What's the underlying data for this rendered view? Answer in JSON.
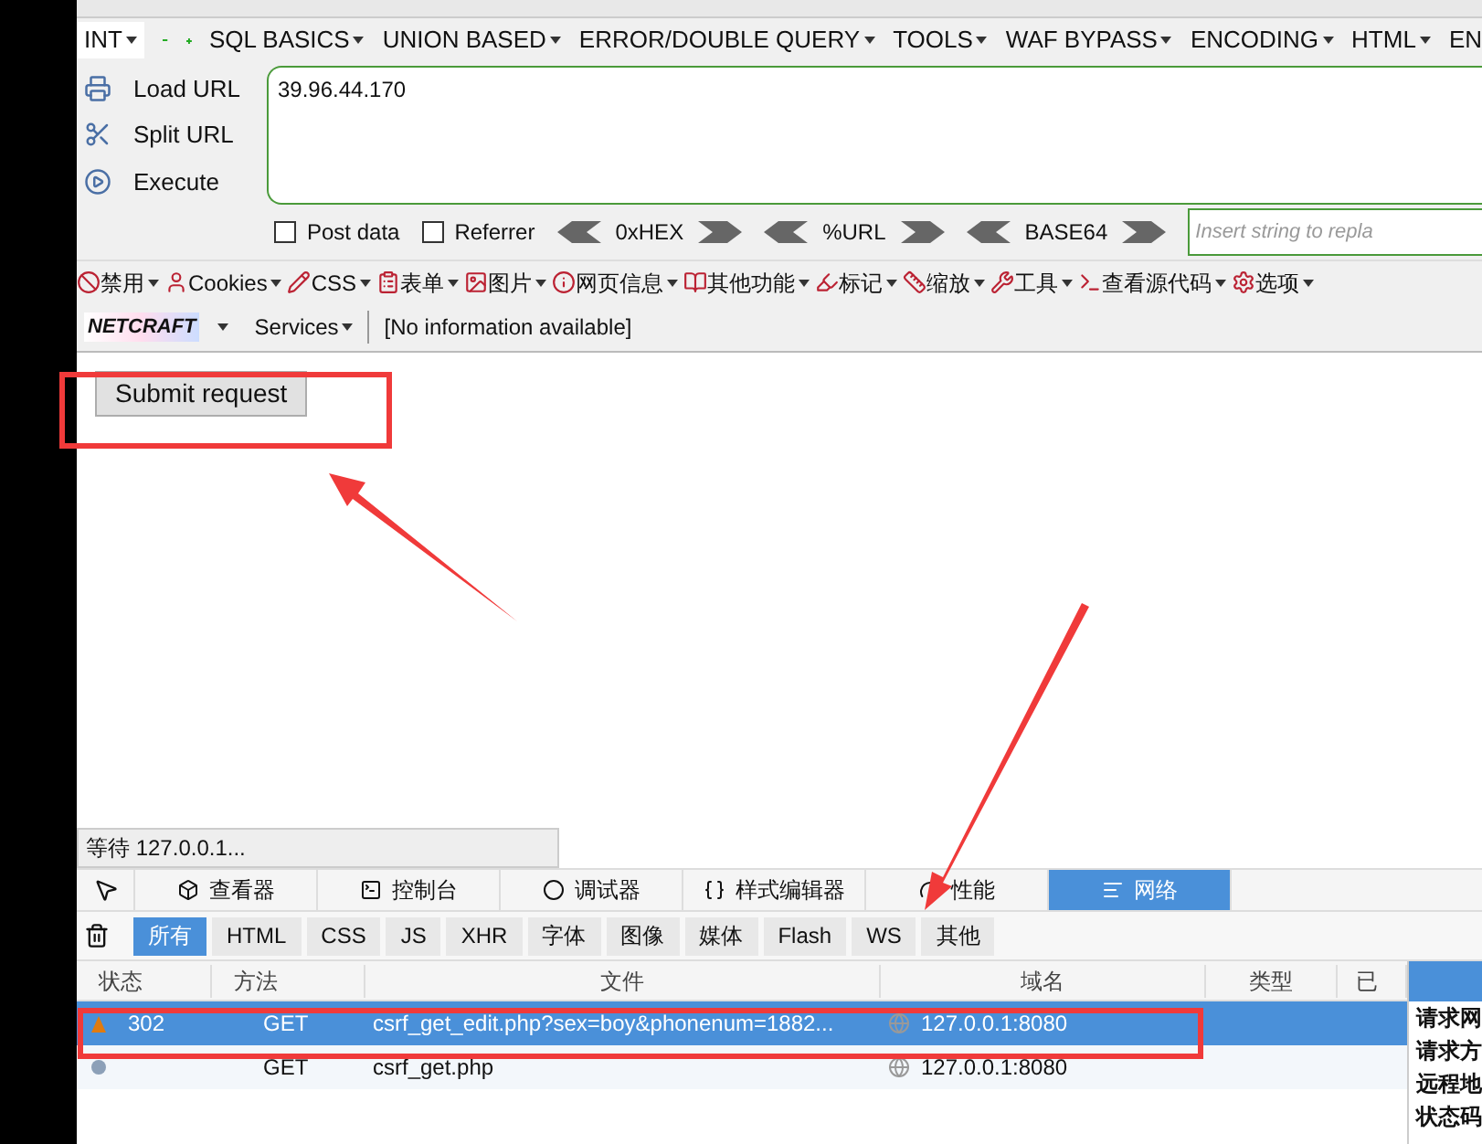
{
  "hackbar": {
    "select_value": "INT",
    "menus": [
      "SQL BASICS",
      "UNION BASED",
      "ERROR/DOUBLE QUERY",
      "TOOLS",
      "WAF BYPASS",
      "ENCODING",
      "HTML",
      "EN"
    ]
  },
  "url_actions": [
    {
      "label": "Load URL",
      "kind": "load"
    },
    {
      "label": "Split URL",
      "kind": "split"
    },
    {
      "label": "Execute",
      "kind": "execute"
    }
  ],
  "url_field": {
    "value": "39.96.44.170"
  },
  "options": {
    "checkboxes": [
      {
        "label": "Post data",
        "checked": false
      },
      {
        "label": "Referrer",
        "checked": false
      }
    ],
    "encoders": [
      "0xHEX",
      "%URL",
      "BASE64"
    ],
    "insert_field": {
      "placeholder": "Insert string to repla"
    }
  },
  "addon_toolbar": [
    "禁用",
    "Cookies",
    "CSS",
    "表单",
    "图片",
    "网页信息",
    "其他功能",
    "标记",
    "缩放",
    "工具",
    "查看源代码",
    "选项"
  ],
  "netcraft": {
    "logo": "NETCRAFT",
    "services": "Services",
    "info": "[No information available]"
  },
  "page": {
    "submit_button": "Submit request"
  },
  "status_text": "等待 127.0.0.1...",
  "devtools": {
    "tabs": [
      {
        "label": "查看器",
        "kind": "inspector",
        "selected": false
      },
      {
        "label": "控制台",
        "kind": "console",
        "selected": false
      },
      {
        "label": "调试器",
        "kind": "debugger",
        "selected": false
      },
      {
        "label": "样式编辑器",
        "kind": "style",
        "selected": false
      },
      {
        "label": "性能",
        "kind": "performance",
        "selected": false
      },
      {
        "label": "网络",
        "kind": "network",
        "selected": true
      }
    ],
    "filters": [
      {
        "label": "所有",
        "selected": true
      },
      {
        "label": "HTML",
        "selected": false
      },
      {
        "label": "CSS",
        "selected": false
      },
      {
        "label": "JS",
        "selected": false
      },
      {
        "label": "XHR",
        "selected": false
      },
      {
        "label": "字体",
        "selected": false
      },
      {
        "label": "图像",
        "selected": false
      },
      {
        "label": "媒体",
        "selected": false
      },
      {
        "label": "Flash",
        "selected": false
      },
      {
        "label": "WS",
        "selected": false
      },
      {
        "label": "其他",
        "selected": false
      }
    ],
    "columns": [
      "状态",
      "方法",
      "文件",
      "域名",
      "类型",
      "已"
    ],
    "rows": [
      {
        "kind": "warning",
        "status": "302",
        "method": "GET",
        "file": "csrf_get_edit.php?sex=boy&phonenum=1882...",
        "domain": "127.0.0.1:8080",
        "selected": true
      },
      {
        "kind": "pending",
        "status": "",
        "method": "GET",
        "file": "csrf_get.php",
        "domain": "127.0.0.1:8080",
        "selected": false
      }
    ],
    "side_panel": [
      "请求网",
      "请求方",
      "远程地",
      "状态码"
    ]
  }
}
